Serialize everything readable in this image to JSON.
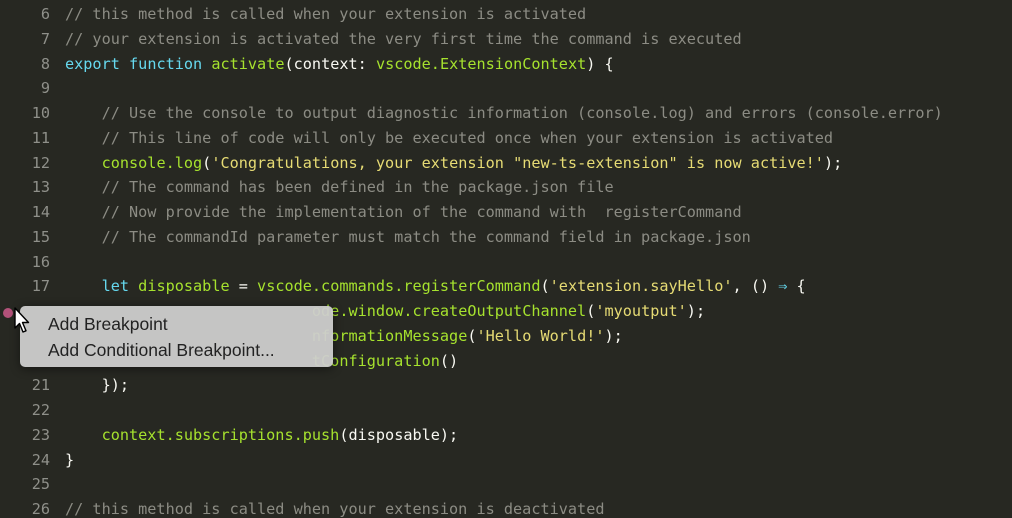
{
  "editor": {
    "lines": [
      {
        "n": "6",
        "tokens": [
          [
            "c",
            "// this method is called when your extension is activated"
          ]
        ]
      },
      {
        "n": "7",
        "tokens": [
          [
            "c",
            "// your extension is activated the very first time the command is executed"
          ]
        ]
      },
      {
        "n": "8",
        "tokens": [
          [
            "k",
            "export"
          ],
          [
            "p",
            " "
          ],
          [
            "k",
            "function"
          ],
          [
            "p",
            " "
          ],
          [
            "f",
            "activate"
          ],
          [
            "p",
            "(context: "
          ],
          [
            "f",
            "vscode.ExtensionContext"
          ],
          [
            "p",
            ") {"
          ]
        ]
      },
      {
        "n": "9",
        "tokens": []
      },
      {
        "n": "10",
        "tokens": [
          [
            "p",
            "    "
          ],
          [
            "c",
            "// Use the console to output diagnostic information (console.log) and errors (console.error)"
          ]
        ]
      },
      {
        "n": "11",
        "tokens": [
          [
            "p",
            "    "
          ],
          [
            "c",
            "// This line of code will only be executed once when your extension is activated"
          ]
        ]
      },
      {
        "n": "12",
        "tokens": [
          [
            "p",
            "    "
          ],
          [
            "f",
            "console.log"
          ],
          [
            "p",
            "("
          ],
          [
            "s",
            "'Congratulations, your extension \"new-ts-extension\" is now active!'"
          ],
          [
            "p",
            ");"
          ]
        ]
      },
      {
        "n": "13",
        "tokens": [
          [
            "p",
            "    "
          ],
          [
            "c",
            "// The command has been defined in the package.json file"
          ]
        ]
      },
      {
        "n": "14",
        "tokens": [
          [
            "p",
            "    "
          ],
          [
            "c",
            "// Now provide the implementation of the command with  registerCommand"
          ]
        ]
      },
      {
        "n": "15",
        "tokens": [
          [
            "p",
            "    "
          ],
          [
            "c",
            "// The commandId parameter must match the command field in package.json"
          ]
        ]
      },
      {
        "n": "16",
        "tokens": []
      },
      {
        "n": "17",
        "tokens": [
          [
            "p",
            "    "
          ],
          [
            "k",
            "let"
          ],
          [
            "p",
            " "
          ],
          [
            "f",
            "disposable"
          ],
          [
            "p",
            " = "
          ],
          [
            "f",
            "vscode.commands.registerCommand"
          ],
          [
            "p",
            "("
          ],
          [
            "s",
            "'extension.sayHello'"
          ],
          [
            "p",
            ", () "
          ],
          [
            "o",
            "⇒"
          ],
          [
            "p",
            " {"
          ]
        ]
      },
      {
        "n": "",
        "tokens": [
          [
            "p",
            "                           "
          ],
          [
            "f",
            "ode.window.createOutputChannel"
          ],
          [
            "p",
            "("
          ],
          [
            "s",
            "'myoutput'"
          ],
          [
            "p",
            ");"
          ]
        ]
      },
      {
        "n": "",
        "tokens": [
          [
            "p",
            "                           "
          ],
          [
            "f",
            "nformationMessage"
          ],
          [
            "p",
            "("
          ],
          [
            "s",
            "'Hello World!'"
          ],
          [
            "p",
            ");"
          ]
        ]
      },
      {
        "n": "",
        "tokens": [
          [
            "p",
            "                           "
          ],
          [
            "f",
            "tConfiguration"
          ],
          [
            "p",
            "()"
          ]
        ]
      },
      {
        "n": "21",
        "tokens": [
          [
            "p",
            "    });"
          ]
        ]
      },
      {
        "n": "22",
        "tokens": []
      },
      {
        "n": "23",
        "tokens": [
          [
            "p",
            "    "
          ],
          [
            "f",
            "context.subscriptions.push"
          ],
          [
            "p",
            "(disposable);"
          ]
        ]
      },
      {
        "n": "24",
        "tokens": [
          [
            "p",
            "}"
          ]
        ]
      },
      {
        "n": "25",
        "tokens": []
      },
      {
        "n": "26",
        "tokens": [
          [
            "c",
            "// this method is called when your extension is deactivated"
          ]
        ]
      }
    ]
  },
  "context_menu": {
    "add_breakpoint": "Add Breakpoint",
    "add_conditional_breakpoint": "Add Conditional Breakpoint..."
  },
  "icons": {
    "breakpoint": "breakpoint-dot-icon",
    "cursor": "mouse-pointer-icon"
  },
  "colors": {
    "background": "#272822",
    "comment": "#8c8c84",
    "keyword": "#66d9ef",
    "function": "#a6e22e",
    "string": "#e6db74",
    "breakpoint": "#b3527a"
  }
}
